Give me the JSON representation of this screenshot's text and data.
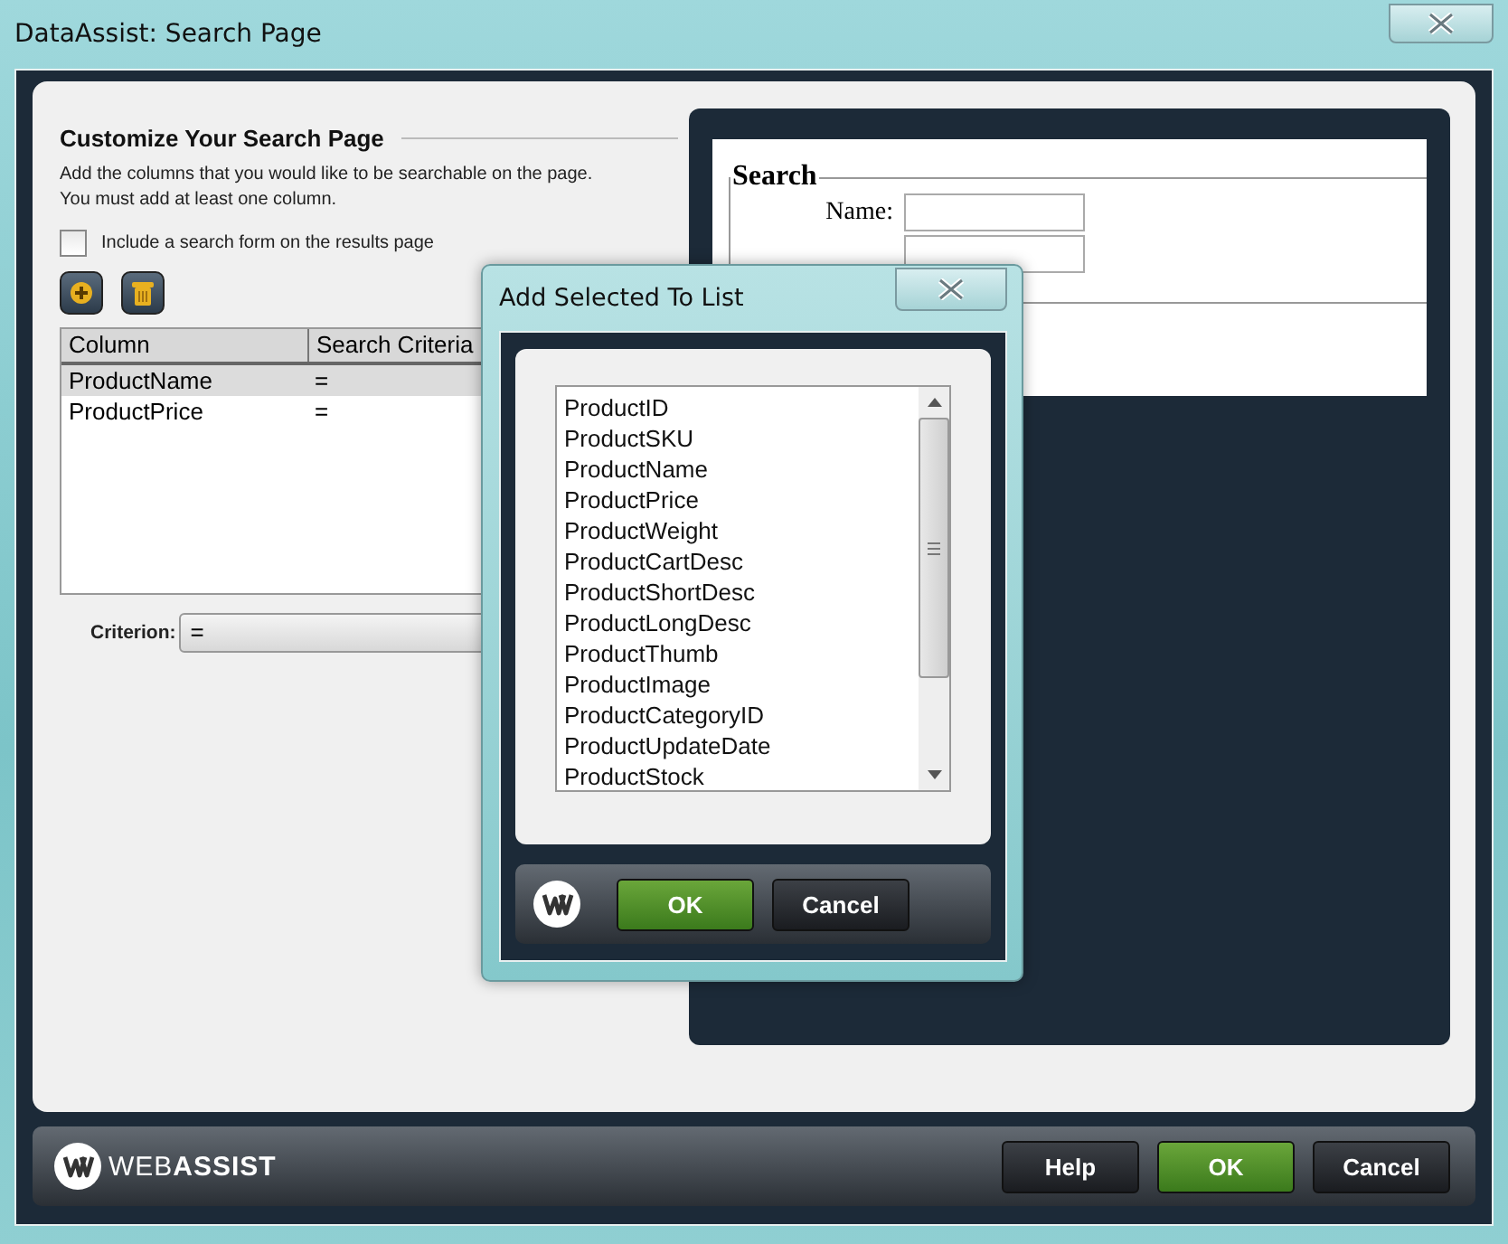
{
  "window": {
    "title": "DataAssist: Search Page"
  },
  "section": {
    "heading": "Customize Your Search Page",
    "description": [
      "Add the columns that you would like to be searchable on the page.",
      "You must add at least one column."
    ],
    "option": {
      "label": "Include a search form on the results page",
      "checked": false
    },
    "table": {
      "columns": [
        "Column",
        "Search Criteria"
      ],
      "rows": [
        {
          "cells": [
            "ProductName",
            "="
          ],
          "selected": true
        },
        {
          "cells": [
            "ProductPrice",
            "="
          ],
          "selected": false
        }
      ]
    },
    "criterion": {
      "label": "Criterion:",
      "value": "="
    }
  },
  "preview": {
    "legend": "Search",
    "fields": [
      {
        "kind": "labeled",
        "label": "Name:"
      },
      {
        "kind": "covered"
      }
    ]
  },
  "dialog": {
    "title": "Add Selected To List",
    "items": [
      "ProductID",
      "ProductSKU",
      "ProductName",
      "ProductPrice",
      "ProductWeight",
      "ProductCartDesc",
      "ProductShortDesc",
      "ProductLongDesc",
      "ProductThumb",
      "ProductImage",
      "ProductCategoryID",
      "ProductUpdateDate",
      "ProductStock"
    ],
    "buttons": [
      {
        "label": "OK",
        "kind": "primary"
      },
      {
        "label": "Cancel",
        "kind": "secondary"
      }
    ]
  },
  "footer": {
    "brand": "WEB**ASSIST**",
    "buttons": [
      {
        "label": "Help",
        "kind": "secondary"
      },
      {
        "label": "OK",
        "kind": "primary"
      },
      {
        "label": "Cancel",
        "kind": "secondary"
      }
    ]
  }
}
